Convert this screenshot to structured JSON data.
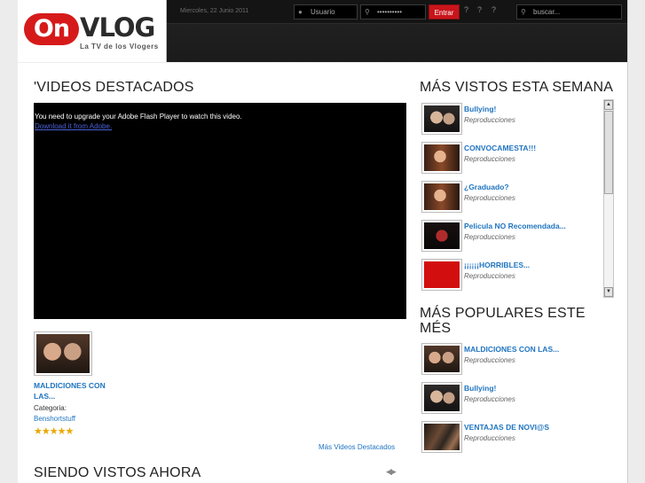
{
  "header": {
    "logo_on": "On",
    "logo_vlog": "VLOG",
    "tagline": "La TV de los Vlogers",
    "date": "Miercoles, 22 Junio 2011",
    "user_placeholder": "Usuario",
    "password_value": "••••••••••",
    "login_button": "Entrar",
    "help_glyph": "?",
    "search_placeholder": "buscar..."
  },
  "featured": {
    "title": "'VIDEOS DESTACADOS",
    "flash_message": "You need to upgrade your Adobe Flash Player to watch this video.",
    "flash_link": "Download it from Adobe.",
    "video_title": "MALDICIONES CON LAS...",
    "category_label": "Categoria:",
    "category_value": "Benshortstuff",
    "rating_stars": "★★★★★",
    "more_link": "Más Videos Destacados"
  },
  "watching": {
    "title": "SIENDO VISTOS AHORA",
    "arrows": "◀▶"
  },
  "week": {
    "title": "MÁS VISTOS ESTA SEMANA",
    "items": [
      {
        "title": "Bullying!",
        "meta": "Reproducciones"
      },
      {
        "title": "CONVOCAMESTA!!!",
        "meta": "Reproducciones"
      },
      {
        "title": "¿Graduado?",
        "meta": "Reproducciones"
      },
      {
        "title": "Pelicula NO Recomendada...",
        "meta": "Reproducciones"
      },
      {
        "title": "¡¡¡¡¡¡HORRIBLES...",
        "meta": "Reproducciones"
      }
    ]
  },
  "popular": {
    "title": "MÁS POPULARES ESTE MÉS",
    "items": [
      {
        "title": "MALDICIONES CON LAS...",
        "meta": "Reproducciones"
      },
      {
        "title": "Bullying!",
        "meta": "Reproducciones"
      },
      {
        "title": "VENTAJAS DE NOVI@S",
        "meta": "Reproducciones"
      }
    ]
  },
  "scrollbar": {
    "up": "▲",
    "down": "▼"
  },
  "colors": {
    "brand_red": "#d61a1a",
    "link_blue": "#1f74c0",
    "topbar": "#1b1b1b"
  }
}
